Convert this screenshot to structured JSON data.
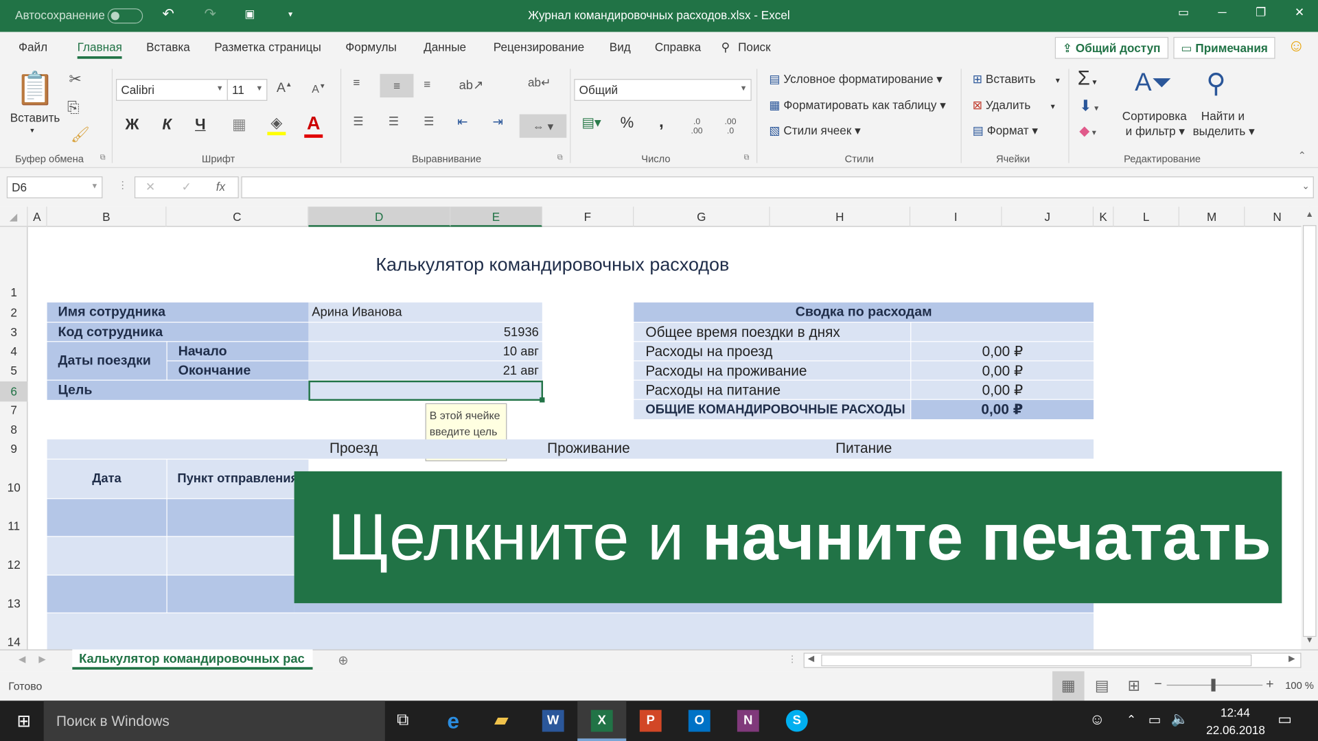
{
  "titlebar": {
    "autosave_label": "Автосохранение",
    "file_title": "Журнал командировочных расходов.xlsx  -  Excel"
  },
  "tabs": [
    "Файл",
    "Главная",
    "Вставка",
    "Разметка страницы",
    "Формулы",
    "Данные",
    "Рецензирование",
    "Вид",
    "Справка",
    "Поиск"
  ],
  "ribbon_actions": {
    "share": "Общий доступ",
    "comments": "Примечания"
  },
  "ribbon": {
    "paste_label": "Вставить",
    "font_name": "Calibri",
    "font_size": "11",
    "bold": "Ж",
    "italic": "К",
    "underline": "Ч",
    "number_format": "Общий",
    "cond_format": "Условное форматирование",
    "format_table": "Форматировать как таблицу",
    "cell_styles": "Стили ячеек",
    "insert": "Вставить",
    "delete": "Удалить",
    "format": "Формат",
    "sort1": "Сортировка",
    "sort2": "и фильтр",
    "find1": "Найти и",
    "find2": "выделить",
    "groups": [
      "Буфер обмена",
      "Шрифт",
      "Выравнивание",
      "Число",
      "Стили",
      "Ячейки",
      "Редактирование"
    ]
  },
  "formula_bar": {
    "name_box": "D6",
    "fx": "fx",
    "formula": ""
  },
  "columns": [
    "A",
    "B",
    "C",
    "D",
    "E",
    "F",
    "G",
    "H",
    "I",
    "J",
    "K",
    "L",
    "M",
    "N"
  ],
  "rows": [
    "1",
    "2",
    "3",
    "4",
    "5",
    "6",
    "7",
    "8",
    "9",
    "10",
    "11",
    "12",
    "13",
    "14"
  ],
  "sheet": {
    "title": "Калькулятор командировочных расходов",
    "emp_name_label": "Имя сотрудника",
    "emp_name": "Арина Иванова",
    "emp_code_label": "Код сотрудника",
    "emp_code": "51936",
    "dates_label": "Даты поездки",
    "start_label": "Начало",
    "start_value": "10 авг",
    "end_label": "Окончание",
    "end_value": "21 авг",
    "goal_label": "Цель",
    "tooltip": "В этой ячейке введите цель поездки.",
    "summary_title": "Сводка по расходам",
    "summary": [
      {
        "label": "Общее время поездки в днях",
        "value": ""
      },
      {
        "label": "Расходы на проезд",
        "value": "0,00 ₽"
      },
      {
        "label": "Расходы на проживание",
        "value": "0,00 ₽"
      },
      {
        "label": "Расходы на питание",
        "value": "0,00 ₽"
      }
    ],
    "total_label": "ОБЩИЕ КОМАНДИРОВОЧНЫЕ РАСХОДЫ",
    "total_value": "0,00 ₽",
    "h_travel": "Проезд",
    "h_lodging": "Проживание",
    "h_meals": "Питание",
    "h_date": "Дата",
    "h_departure": "Пункт отправления"
  },
  "overlay": {
    "normal": "Щелкните и ",
    "bold": "начните печатать"
  },
  "sheet_tab": "Калькулятор командировочных рас",
  "status": {
    "ready": "Готово",
    "zoom": "100 %"
  },
  "taskbar": {
    "search": "Поиск в Windows",
    "time": "12:44",
    "date": "22.06.2018"
  },
  "colors": {
    "excel_green": "#217346",
    "label_blue": "#b4c6e7",
    "value_blue": "#dae3f3"
  }
}
